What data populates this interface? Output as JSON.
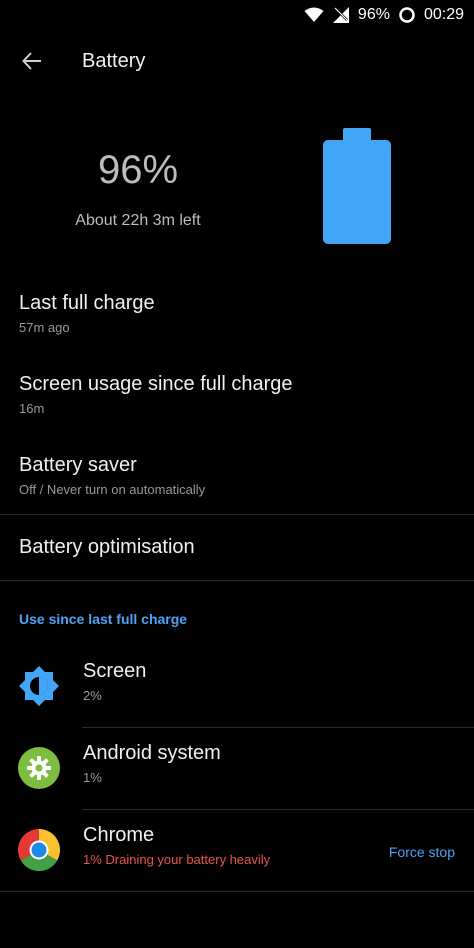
{
  "status_bar": {
    "battery_percent": "96%",
    "time": "00:29",
    "icons": [
      "wifi-icon",
      "no-signal-icon",
      "battery-ring-icon"
    ]
  },
  "toolbar": {
    "title": "Battery",
    "back_icon": "arrow-back-icon"
  },
  "hero": {
    "percent": "96%",
    "remaining": "About 22h 3m left",
    "level": 0.96
  },
  "rows": {
    "last_full_charge": {
      "title": "Last full charge",
      "subtitle": "57m ago"
    },
    "screen_usage": {
      "title": "Screen usage since full charge",
      "subtitle": "16m"
    },
    "battery_saver": {
      "title": "Battery saver",
      "subtitle": "Off / Never turn on automatically"
    },
    "battery_optimisation": {
      "title": "Battery optimisation"
    }
  },
  "usage_section": {
    "header": "Use since last full charge",
    "apps": [
      {
        "name": "Screen",
        "usage": "2%",
        "icon": "brightness-icon"
      },
      {
        "name": "Android system",
        "usage": "1%",
        "icon": "android-settings-icon"
      },
      {
        "name": "Chrome",
        "usage": "1% Draining your battery heavily",
        "icon": "chrome-icon",
        "action": "Force stop"
      }
    ]
  },
  "colors": {
    "accent": "#4da3f5",
    "battery_fill": "#42a5f5",
    "warning": "#e8564a",
    "background": "#000000"
  }
}
